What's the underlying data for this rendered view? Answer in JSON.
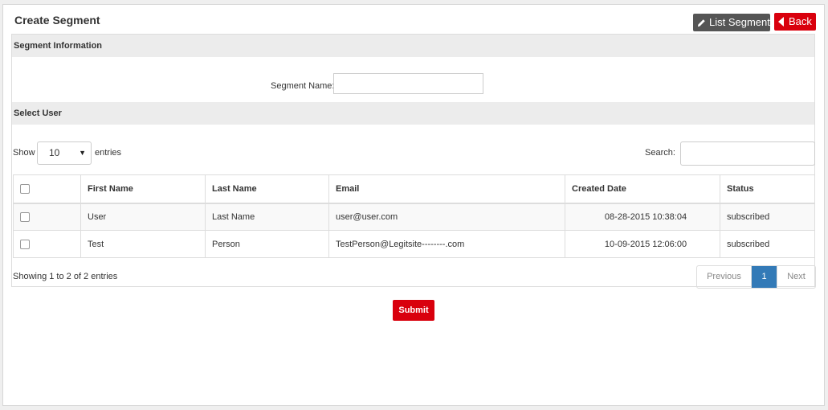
{
  "header": {
    "title": "Create Segment",
    "list_segment_label": "List Segment",
    "back_label": "Back"
  },
  "segment_info": {
    "heading": "Segment Information",
    "name_label": "Segment Name:",
    "name_value": ""
  },
  "select_user": {
    "heading": "Select User",
    "show_label": "Show",
    "page_size": "10",
    "entries_label": "entries",
    "search_label": "Search:",
    "search_value": ""
  },
  "table": {
    "columns": [
      "First Name",
      "Last Name",
      "Email",
      "Created Date",
      "Status"
    ],
    "rows": [
      {
        "first": "User",
        "last": "Last Name",
        "email": "user@user.com",
        "created": "08-28-2015 10:38:04",
        "status": "subscribed"
      },
      {
        "first": "Test",
        "last": "Person",
        "email": "TestPerson@Legitsite--------.com",
        "created": "10-09-2015 12:06:00",
        "status": "subscribed"
      }
    ]
  },
  "footer": {
    "info": "Showing 1 to 2 of 2 entries",
    "previous": "Previous",
    "page": "1",
    "next": "Next"
  },
  "submit_label": "Submit",
  "colors": {
    "accent_red": "#d9000d",
    "dark_button": "#555555",
    "pager_active": "#337ab7"
  }
}
